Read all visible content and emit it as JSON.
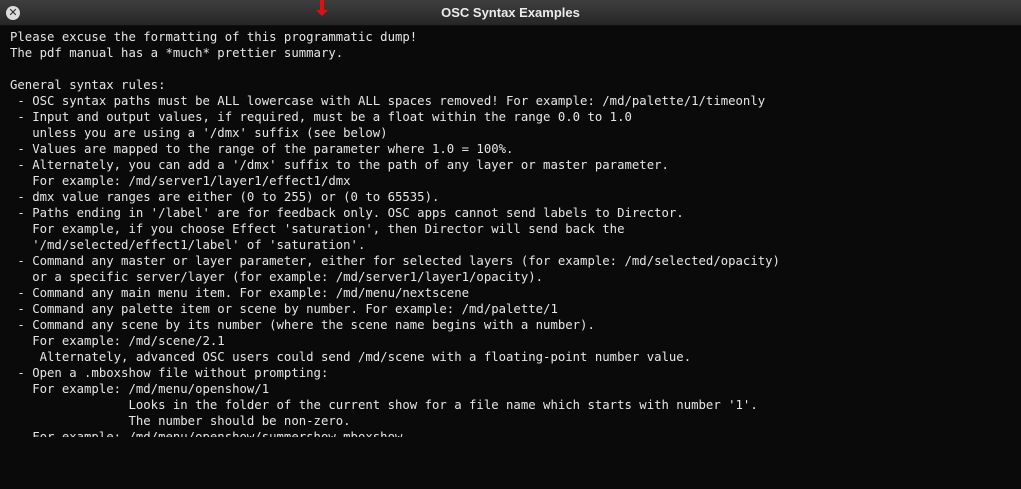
{
  "window": {
    "title": "OSC Syntax Examples",
    "close_icon": "close-icon",
    "background_color": "#0a0a0a",
    "text_color": "#e6e6e6"
  },
  "lines": [
    "Please excuse the formatting of this programmatic dump!",
    "The pdf manual has a *much* prettier summary.",
    "",
    "General syntax rules:",
    " - OSC syntax paths must be ALL lowercase with ALL spaces removed! For example: /md/palette/1/timeonly",
    " - Input and output values, if required, must be a float within the range 0.0 to 1.0",
    "   unless you are using a '/dmx' suffix (see below)",
    " - Values are mapped to the range of the parameter where 1.0 = 100%.",
    " - Alternately, you can add a '/dmx' suffix to the path of any layer or master parameter.",
    "   For example: /md/server1/layer1/effect1/dmx",
    " - dmx value ranges are either (0 to 255) or (0 to 65535).",
    " - Paths ending in '/label' are for feedback only. OSC apps cannot send labels to Director.",
    "   For example, if you choose Effect 'saturation', then Director will send back the",
    "   '/md/selected/effect1/label' of 'saturation'.",
    " - Command any master or layer parameter, either for selected layers (for example: /md/selected/opacity)",
    "   or a specific server/layer (for example: /md/server1/layer1/opacity).",
    " - Command any main menu item. For example: /md/menu/nextscene",
    " - Command any palette item or scene by number. For example: /md/palette/1",
    " - Command any scene by its number (where the scene name begins with a number).",
    "   For example: /md/scene/2.1",
    "    Alternately, advanced OSC users could send /md/scene with a floating-point number value.",
    " - Open a .mboxshow file without prompting:",
    "   For example: /md/menu/openshow/1",
    "                Looks in the folder of the current show for a file name which starts with number '1'.",
    "                The number should be non-zero.",
    "   For example: /md/menu/openshow/summershow.mboxshow"
  ]
}
